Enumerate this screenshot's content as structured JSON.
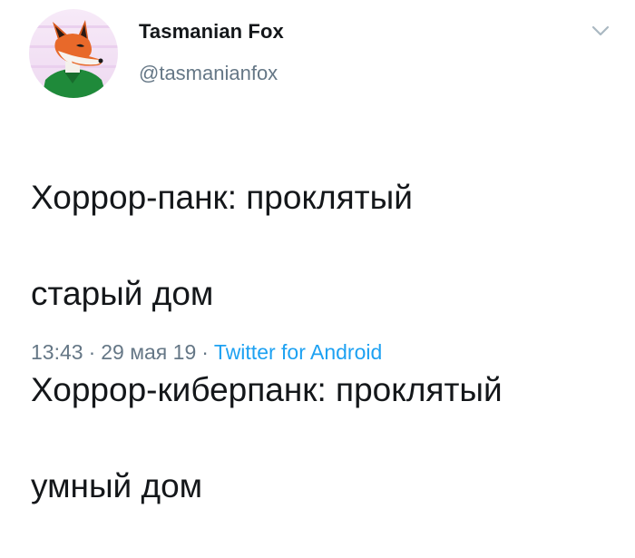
{
  "author": {
    "display_name": "Tasmanian Fox",
    "handle": "@tasmanianfox"
  },
  "tweet": {
    "lines": [
      "Хоррор-панк: проклятый",
      "старый дом",
      "Хоррор-киберпанк: проклятый",
      "умный дом"
    ]
  },
  "meta": {
    "time": "13:43",
    "separator": "·",
    "date": "29 мая 19",
    "client": "Twitter for Android"
  },
  "colors": {
    "text_primary": "#14171a",
    "text_secondary": "#657786",
    "link": "#1da1f2",
    "avatar_background": "#f3e3f6",
    "fox_orange": "#e8692a",
    "shirt_green": "#1f8a3a"
  },
  "icons": {
    "menu": "chevron-down-icon",
    "avatar": "fox-avatar"
  }
}
